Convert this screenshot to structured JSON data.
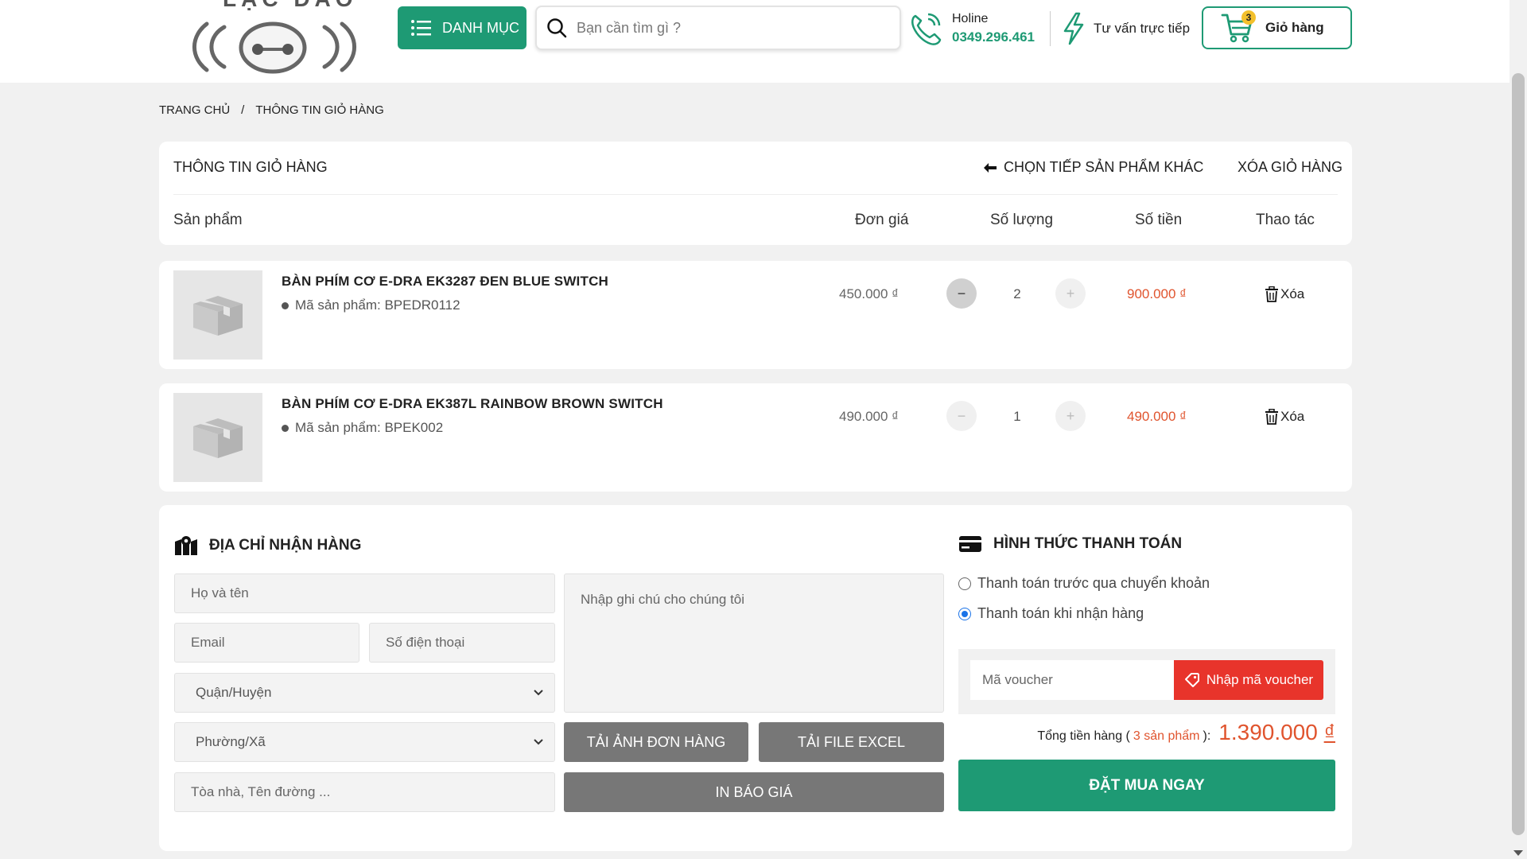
{
  "colors": {
    "brand": "#1e9a74",
    "accent_red": "#e8342b",
    "price_orange": "#e0542e",
    "gray_button": "#777777"
  },
  "header": {
    "logo_text": "LẠC ĐÀO",
    "category_label": "DANH MỤC",
    "search_placeholder": "Bạn cần tìm gì ?",
    "hotline_label": "Holine",
    "hotline_number": "0349.296.461",
    "consult_label": "Tư vấn trực tiếp",
    "cart_label": "Giỏ hàng",
    "cart_count": "3",
    "icons": [
      "menu-icon",
      "search-icon",
      "phone-icon",
      "lightning-icon",
      "cart-icon"
    ]
  },
  "breadcrumb": {
    "home": "TRANG CHỦ",
    "sep": "/",
    "current": "THÔNG TIN GIỎ HÀNG"
  },
  "cart": {
    "title": "THÔNG TIN GIỎ HÀNG",
    "continue_label": "CHỌN TIẾP SẢN PHẨM KHÁC",
    "clear_label": "XÓA GIỎ HÀNG",
    "columns": {
      "product": "Sản phẩm",
      "unit_price": "Đơn giá",
      "quantity": "Số lượng",
      "amount": "Số tiền",
      "action": "Thao tác"
    },
    "items": [
      {
        "name": "BÀN PHÍM CƠ E-DRA EK3287 ĐEN BLUE SWITCH",
        "code": "Mã sản phẩm: BPEDR0112",
        "price": "450.000 ₫",
        "qty": "2",
        "minus": "−",
        "plus": "+",
        "total": "900.000 ₫",
        "delete": "Xóa"
      },
      {
        "name": "BÀN PHÍM CƠ E-DRA EK387L RAINBOW BROWN SWITCH",
        "code": "Mã sản phẩm: BPEK002",
        "price": "490.000 ₫",
        "qty": "1",
        "minus": "−",
        "plus": "+",
        "total": "490.000 ₫",
        "delete": "Xóa"
      }
    ]
  },
  "address": {
    "title": "ĐỊA CHỈ NHẬN HÀNG",
    "name_placeholder": "Họ và tên",
    "email_placeholder": "Email",
    "phone_placeholder": "Số điện thoại",
    "district": "Quận/Huyện",
    "ward": "Phường/Xã",
    "street_placeholder": "Tòa nhà, Tên đường ...",
    "note_placeholder": "Nhập ghi chú cho chúng tôi",
    "download_image": "TẢI ẢNH ĐƠN HÀNG",
    "download_excel": "TẢI FILE EXCEL",
    "print_quote": "IN BÁO GIÁ"
  },
  "payment": {
    "title": "HÌNH THỨC THANH TOÁN",
    "option_transfer": "Thanh toán trước qua chuyển khoản",
    "option_cod": "Thanh toán khi nhận hàng",
    "selected": "cod",
    "voucher_placeholder": "Mã voucher",
    "voucher_button": "Nhập mã voucher",
    "total_label": "Tổng tiền hàng (",
    "total_count": "3 sản phẩm",
    "total_label_end": " ):",
    "total_value": "1.390.000",
    "currency": "₫",
    "order_button": "ĐẶT MUA NGAY"
  }
}
